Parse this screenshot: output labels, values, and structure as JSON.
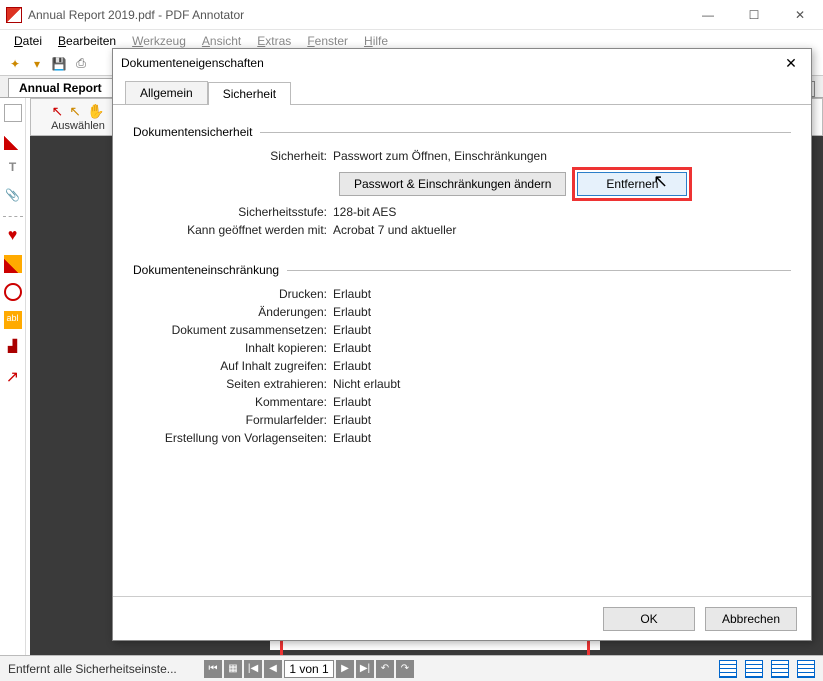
{
  "window": {
    "title": "Annual Report 2019.pdf - PDF Annotator"
  },
  "menus": {
    "datei": "Datei",
    "bearbeiten": "Bearbeiten",
    "werkzeug": "Werkzeug",
    "ansicht": "Ansicht",
    "extras": "Extras",
    "fenster": "Fenster",
    "hilfe": "Hilfe"
  },
  "doc_tab": "Annual Report",
  "tool_panel": {
    "label": "Auswählen"
  },
  "statusbar": {
    "text": "Entfernt alle Sicherheitseinste...",
    "page_indicator": "1 von 1"
  },
  "dialog": {
    "title": "Dokumenteneigenschaften",
    "tabs": {
      "general": "Allgemein",
      "security": "Sicherheit"
    },
    "group_security": "Dokumentensicherheit",
    "group_restrict": "Dokumenteneinschränkung",
    "rows": {
      "sicherheit_k": "Sicherheit:",
      "sicherheit_v": "Passwort zum Öffnen, Einschränkungen",
      "change_btn": "Passwort & Einschränkungen ändern",
      "remove_btn": "Entfernen",
      "stufe_k": "Sicherheitsstufe:",
      "stufe_v": "128-bit AES",
      "open_k": "Kann geöffnet werden mit:",
      "open_v": "Acrobat 7 und aktueller",
      "drucken_k": "Drucken:",
      "drucken_v": "Erlaubt",
      "aender_k": "Änderungen:",
      "aender_v": "Erlaubt",
      "zusammen_k": "Dokument zusammensetzen:",
      "zusammen_v": "Erlaubt",
      "kopieren_k": "Inhalt kopieren:",
      "kopieren_v": "Erlaubt",
      "zugriff_k": "Auf Inhalt zugreifen:",
      "zugriff_v": "Erlaubt",
      "extrah_k": "Seiten extrahieren:",
      "extrah_v": "Nicht erlaubt",
      "komment_k": "Kommentare:",
      "komment_v": "Erlaubt",
      "formular_k": "Formularfelder:",
      "formular_v": "Erlaubt",
      "vorlagen_k": "Erstellung von Vorlagenseiten:",
      "vorlagen_v": "Erlaubt"
    },
    "ok": "OK",
    "cancel": "Abbrechen"
  }
}
